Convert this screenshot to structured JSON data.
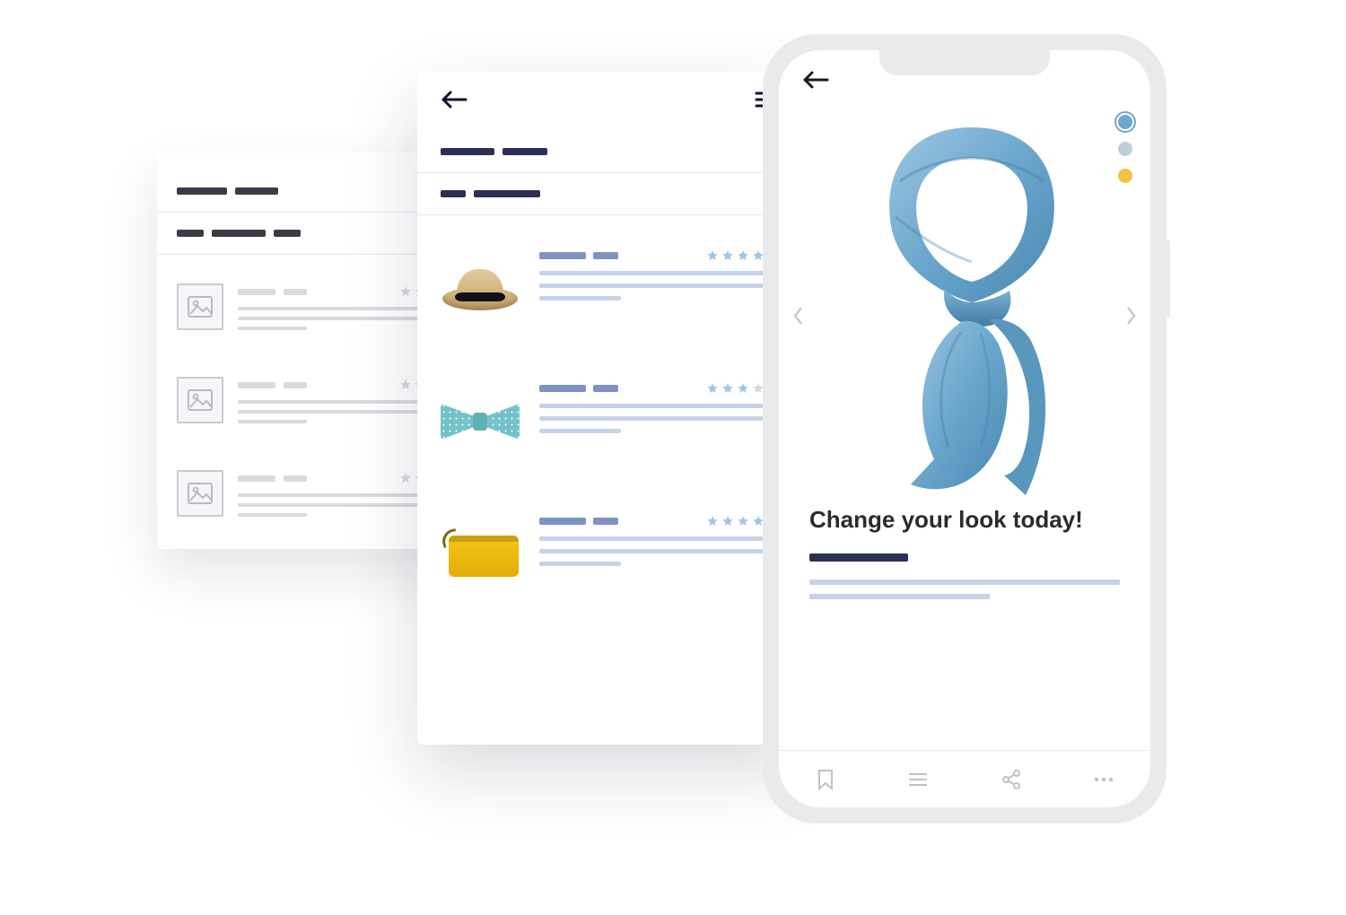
{
  "colors": {
    "navy": "#2e2f56",
    "blue": "#7f93c2",
    "lightblue": "#c6d2e8",
    "accent_scarf": "#6aa6cc",
    "swatch_selected": "#6ea8cf",
    "swatch_2": "#bcd0dc",
    "swatch_3": "#f5c23d"
  },
  "back_card": {
    "filters_count": 2,
    "items": [
      {
        "rating": 0
      },
      {
        "rating": 0
      },
      {
        "rating": 0
      }
    ]
  },
  "mid_card": {
    "filters_count": 2,
    "products": [
      {
        "kind": "hat",
        "rating": 4
      },
      {
        "kind": "bowtie",
        "rating": 3
      },
      {
        "kind": "clutch",
        "rating": 5
      }
    ]
  },
  "phone": {
    "headline": "Change your look today!",
    "swatches": [
      "selected",
      "light",
      "gold"
    ]
  }
}
